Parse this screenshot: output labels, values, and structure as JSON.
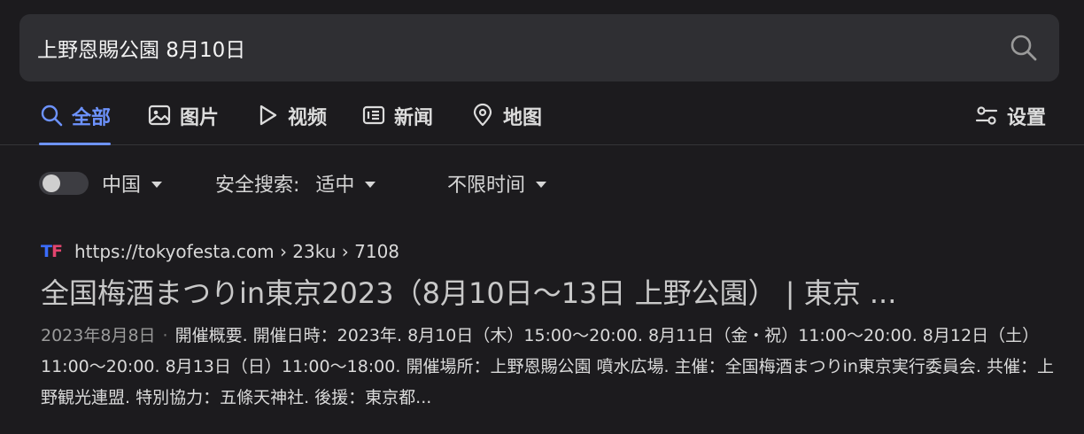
{
  "search": {
    "query": "上野恩賜公園 8月10日"
  },
  "tabs": [
    {
      "label": "全部",
      "icon": "search-icon"
    },
    {
      "label": "图片",
      "icon": "image-icon"
    },
    {
      "label": "视频",
      "icon": "play-icon"
    },
    {
      "label": "新闻",
      "icon": "news-icon"
    },
    {
      "label": "地图",
      "icon": "map-pin-icon"
    }
  ],
  "settings": {
    "label": "设置",
    "icon": "sliders-icon"
  },
  "filters": {
    "region": "中国",
    "safe_search_label": "安全搜索:",
    "safe_search_value": "适中",
    "time": "不限时间"
  },
  "result": {
    "favicon_text_1": "T",
    "favicon_text_2": "F",
    "url": "https://tokyofesta.com › 23ku › 7108",
    "title": "全国梅酒まつりin東京2023（8月10日〜13日 上野公園） | 東京 ...",
    "date": "2023年8月8日",
    "snippet": "開催概要. 開催日時：2023年. 8月10日（木）15:00〜20:00. 8月11日（金・祝）11:00〜20:00. 8月12日（土）11:00〜20:00. 8月13日（日）11:00〜18:00. 開催場所：上野恩賜公園 噴水広場. 主催：全国梅酒まつりin東京実行委員会. 共催：上野観光連盟. 特別協力：五條天神社. 後援：東京都..."
  },
  "colors": {
    "accent": "#6d93ff",
    "background": "#1c1b1e",
    "search_box": "#2f2f33"
  }
}
